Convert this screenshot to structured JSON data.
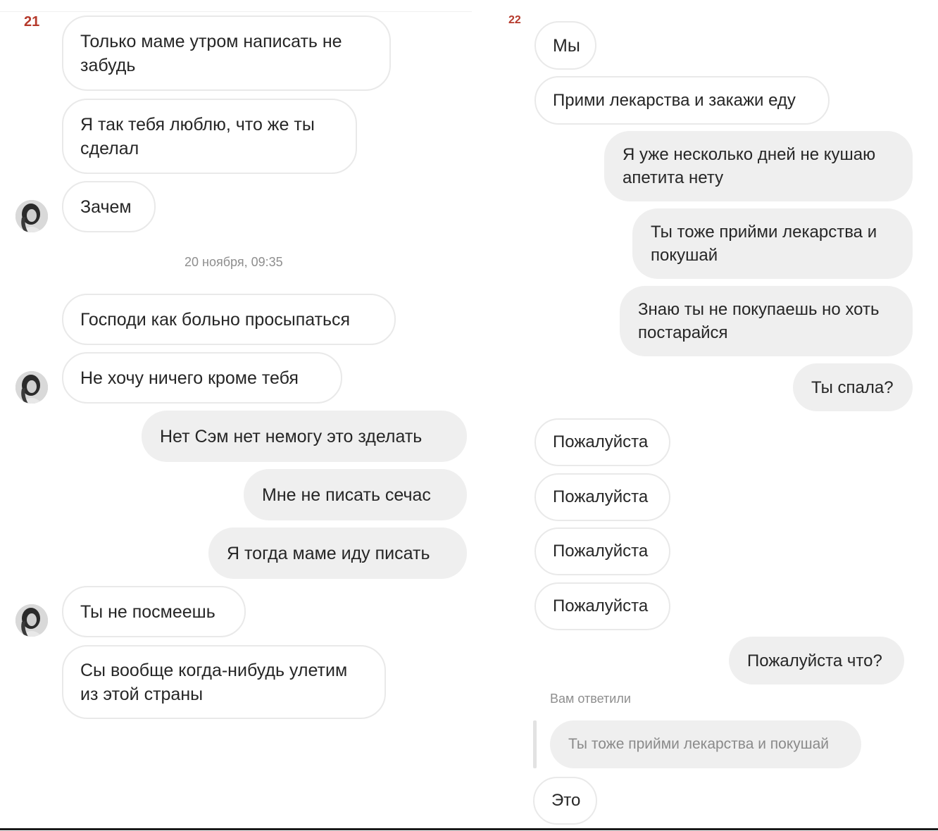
{
  "left_panel": {
    "page_number": "21",
    "messages": [
      {
        "text": "Только маме утром написать не\nзабудь"
      },
      {
        "text": "Я так тебя люблю, что же ты\nсделал"
      },
      {
        "text": "Зачем"
      },
      {
        "text": "Господи как больно просыпаться"
      },
      {
        "text": "Не хочу ничего кроме тебя"
      },
      {
        "text": "Нет Сэм нет немогу это зделать"
      },
      {
        "text": "Мне не писать сечас"
      },
      {
        "text": "Я тогда маме иду писать"
      },
      {
        "text": "Ты не посмеешь"
      },
      {
        "text": "Сы вообще когда-нибудь улетим\nиз этой страны"
      }
    ],
    "date_separator": "20 ноября, 09:35"
  },
  "right_panel": {
    "page_number": "22",
    "messages": [
      {
        "text": "Мы"
      },
      {
        "text": "Прими лекарства и закажи еду"
      },
      {
        "text": "Я уже несколько дней не кушаю\nапетита нету"
      },
      {
        "text": "Ты тоже прийми лекарства и\nпокушай"
      },
      {
        "text": "Знаю ты не покупаешь но хоть\nпостарайся"
      },
      {
        "text": "Ты спала?"
      },
      {
        "text": "Пожалуйста"
      },
      {
        "text": "Пожалуйста"
      },
      {
        "text": "Пожалуйста"
      },
      {
        "text": "Пожалуйста"
      },
      {
        "text": "Пожалуйста что?"
      },
      {
        "text": "Это"
      }
    ],
    "reply": {
      "label": "Вам ответили",
      "quoted_text": "Ты тоже прийми лекарства и покушай"
    }
  },
  "colors": {
    "incoming_bg": "#ffffff",
    "incoming_border": "#e9e9e9",
    "outgoing_bg": "#efefef",
    "page_number": "#b5392b",
    "meta_text": "#8e8e8e"
  }
}
